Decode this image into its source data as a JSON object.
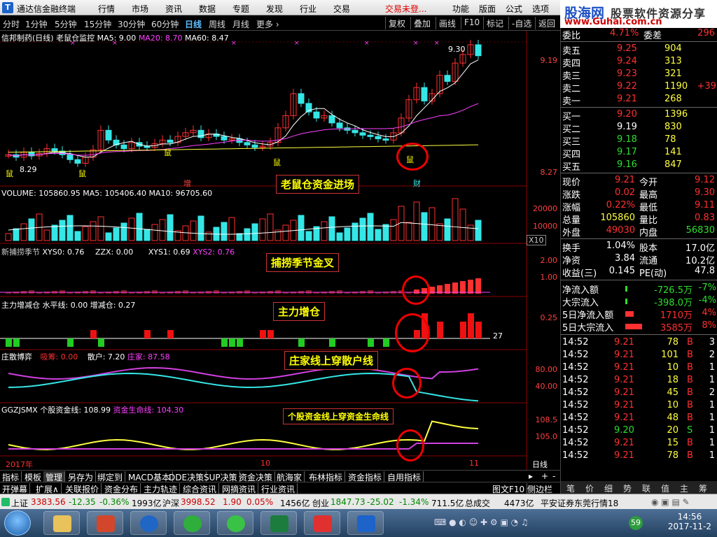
{
  "app": {
    "title": "通达信金融终端"
  },
  "menu": [
    "行情",
    "市场",
    "资讯",
    "数据",
    "专题",
    "发现",
    "行业",
    "交易",
    "交易未登...",
    "功能",
    "版面",
    "公式",
    "选项"
  ],
  "site_logo": {
    "brand": "股海网",
    "slogan": "股票软件资源分享",
    "url": "www.Guhai.com.cn"
  },
  "periods": [
    "分时",
    "1分钟",
    "5分钟",
    "15分钟",
    "30分钟",
    "60分钟",
    "日线",
    "周线",
    "月线",
    "更多 ›"
  ],
  "active_period": "日线",
  "toolbar": [
    "复权",
    "叠加",
    "画线",
    "F10",
    "标记",
    "-自选",
    "返回"
  ],
  "panel_main": {
    "stock": "信邦制药(日线)",
    "indicator": "老鼠仓监控",
    "ma5": "MA5: 9.00",
    "ma20": "MA20: 8.70",
    "ma60": "MA60: 8.47",
    "price_hi": "9.30",
    "price_lo": "8.29",
    "y_top": "9.19",
    "y_bot": "8.27",
    "marks": [
      "鼠",
      "鼠",
      "鼠",
      "鼠",
      "鼠",
      "增",
      "财"
    ],
    "callout": "老鼠仓资金进场"
  },
  "panel_volume": {
    "label": "VOLUME: 105860.95",
    "ma5": "MA5: 105406.40",
    "ma10": "MA10: 96705.60",
    "y1": "20000",
    "y2": "10000",
    "unit": "X10"
  },
  "panel_season": {
    "label": "新捕捞季节",
    "xys0": "XYS0: 0.76",
    "zzx": "ZZX: 0.00",
    "xys1": "XYS1: 0.69",
    "xys2": "XYS2: 0.76",
    "y1": "2.00",
    "y2": "1.00",
    "callout": "捕捞季节金叉"
  },
  "panel_main_force": {
    "label": "主力增减仓",
    "level": "水平线: 0.00",
    "add": "增减仓: 0.27",
    "y1": "0.25",
    "value": "27",
    "callout": "主力增仓"
  },
  "panel_game": {
    "label": "庄散博弈",
    "chip": "吸筹: 0.00",
    "retail": "散户: 7.20",
    "dealer": "庄家: 87.58",
    "y1": "80.00",
    "y2": "40.00",
    "callout": "庄家线上穿散户线"
  },
  "panel_fund": {
    "label": "GGZJSMX",
    "stock_line": "个股资金线: 108.99",
    "life_line": "资金生命线: 104.30",
    "y1": "108.5",
    "y2": "105.0",
    "callout": "个股资金线上穿资金生命线"
  },
  "x_axis": [
    "2017年",
    "10",
    "11"
  ],
  "x_period": "日线",
  "bottom_tabs": [
    "指标",
    "模板",
    "管理",
    "另存为",
    "绑定到",
    "MACD基本",
    "DDE决策",
    "SUP决策",
    "资金决策",
    "航海家",
    "布林指标",
    "资金指标",
    "自用指标"
  ],
  "bottom_tabs_active": "管理",
  "bottom_tabs2": [
    "开弹幕",
    "扩展∧",
    "关联报价",
    "资金分布",
    "主力轨迹",
    "综合资讯",
    "网摘资讯",
    "行业资讯"
  ],
  "bottom_tabs2_right": [
    "图文F10",
    "侧边栏<"
  ],
  "quote": {
    "weibi": {
      "label": "委比",
      "value": "4.71%",
      "label2": "委差",
      "value2": "296"
    },
    "asks": [
      {
        "label": "卖五",
        "price": "9.25",
        "vol": "904",
        "chg": ""
      },
      {
        "label": "卖四",
        "price": "9.24",
        "vol": "313",
        "chg": ""
      },
      {
        "label": "卖三",
        "price": "9.23",
        "vol": "321",
        "chg": ""
      },
      {
        "label": "卖二",
        "price": "9.22",
        "vol": "1190",
        "chg": "+39"
      },
      {
        "label": "卖一",
        "price": "9.21",
        "vol": "268",
        "chg": ""
      }
    ],
    "bids": [
      {
        "label": "买一",
        "price": "9.20",
        "vol": "1396"
      },
      {
        "label": "买二",
        "price": "9.19",
        "vol": "830"
      },
      {
        "label": "买三",
        "price": "9.18",
        "vol": "78"
      },
      {
        "label": "买四",
        "price": "9.17",
        "vol": "141"
      },
      {
        "label": "买五",
        "price": "9.16",
        "vol": "847"
      }
    ],
    "stats": [
      {
        "l1": "现价",
        "v1": "9.21",
        "l2": "今开",
        "v2": "9.12"
      },
      {
        "l1": "涨跌",
        "v1": "0.02",
        "l2": "最高",
        "v2": "9.30"
      },
      {
        "l1": "涨幅",
        "v1": "0.22%",
        "l2": "最低",
        "v2": "9.11"
      },
      {
        "l1": "总量",
        "v1": "105860",
        "l2": "量比",
        "v2": "0.83"
      },
      {
        "l1": "外盘",
        "v1": "49030",
        "l2": "内盘",
        "v2": "56830"
      }
    ],
    "stats2": [
      {
        "l1": "换手",
        "v1": "1.04%",
        "l2": "股本",
        "v2": "17.0亿"
      },
      {
        "l1": "净资",
        "v1": "3.84",
        "l2": "流通",
        "v2": "10.2亿"
      },
      {
        "l1": "收益(三)",
        "v1": "0.145",
        "l2": "PE(动)",
        "v2": "47.8"
      }
    ],
    "flows": [
      {
        "label": "净流入额",
        "value": "-726.5万",
        "pct": "-7%"
      },
      {
        "label": "大宗流入",
        "value": "-398.0万",
        "pct": "-4%"
      },
      {
        "label": "5日净流入额",
        "value": "1710万",
        "pct": "4%"
      },
      {
        "label": "5日大宗流入",
        "value": "3585万",
        "pct": "8%"
      }
    ],
    "ticks": [
      {
        "t": "14:52",
        "p": "9.21",
        "v": "78",
        "d": "B",
        "n": "3"
      },
      {
        "t": "14:52",
        "p": "9.21",
        "v": "101",
        "d": "B",
        "n": "2"
      },
      {
        "t": "14:52",
        "p": "9.21",
        "v": "10",
        "d": "B",
        "n": "1"
      },
      {
        "t": "14:52",
        "p": "9.21",
        "v": "18",
        "d": "B",
        "n": "1"
      },
      {
        "t": "14:52",
        "p": "9.21",
        "v": "45",
        "d": "B",
        "n": "2"
      },
      {
        "t": "14:52",
        "p": "9.21",
        "v": "10",
        "d": "B",
        "n": "1"
      },
      {
        "t": "14:52",
        "p": "9.21",
        "v": "48",
        "d": "B",
        "n": "1"
      },
      {
        "t": "14:52",
        "p": "9.20",
        "v": "20",
        "d": "S",
        "n": "1"
      },
      {
        "t": "14:52",
        "p": "9.21",
        "v": "15",
        "d": "B",
        "n": "1"
      },
      {
        "t": "14:52",
        "p": "9.21",
        "v": "78",
        "d": "B",
        "n": "1"
      }
    ],
    "tabs": [
      "笔",
      "价",
      "细",
      "势",
      "联",
      "值",
      "主",
      "筹"
    ]
  },
  "status": {
    "sh": "上证",
    "sh_val": "3383.56",
    "sh_chg": "-12.35",
    "sh_pct": "-0.36%",
    "sh_amt": "1993亿",
    "sz": "沪深",
    "sz_val": "3998.52",
    "sz_chg": "1.90",
    "sz_pct": "0.05%",
    "sz_amt": "1456亿",
    "cy": "创业",
    "cy_val": "1847.73",
    "cy_chg": "-25.02",
    "cy_pct": "-1.34%",
    "cy_amt": "711.5亿",
    "total": "总成交",
    "total_val": "4473亿",
    "broker": "平安证券东莞行情18"
  },
  "taskbar": {
    "time": "14:56",
    "date": "2017-11-2",
    "badge": "59"
  },
  "colors": {
    "up": "#ff3030",
    "down": "#35e6e6",
    "ma5": "#ffffff",
    "ma20": "#ff40ff",
    "ma60": "#ffff40"
  }
}
